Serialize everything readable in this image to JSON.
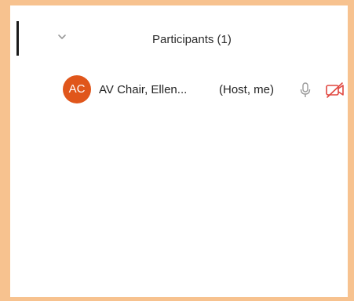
{
  "participants_panel": {
    "title": "Participants (1)",
    "collapse_icon": "chevron-down-icon",
    "participants": [
      {
        "initials": "AC",
        "avatar_color": "#e0561b",
        "name": "AV Chair, Ellen...",
        "role": "(Host, me)",
        "mic_icon": "microphone-icon",
        "video_icon": "video-off-icon",
        "video_status_color": "#e0463f"
      }
    ]
  },
  "frame_color": "#f7c28f"
}
